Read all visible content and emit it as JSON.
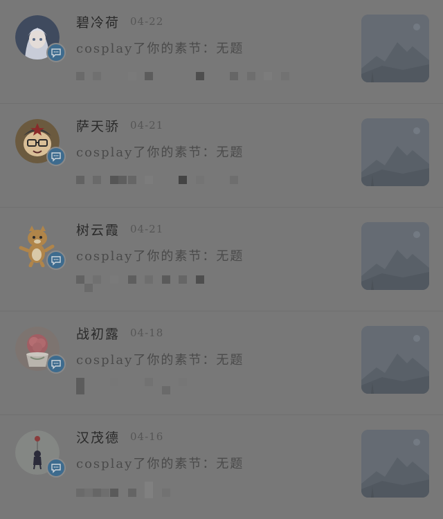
{
  "notifications": [
    {
      "name": "碧冷荷",
      "date": "04-22",
      "message": "cosplay了你的素节：无题",
      "avatar_icon": "anime-girl-avatar-icon",
      "thumbnail_icon": "mountain-placeholder-icon"
    },
    {
      "name": "萨天骄",
      "date": "04-21",
      "message": "cosplay了你的素节：无题",
      "avatar_icon": "cartoon-boy-avatar-icon",
      "thumbnail_icon": "mountain-placeholder-icon"
    },
    {
      "name": "树云霞",
      "date": "04-21",
      "message": "cosplay了你的素节：无题",
      "avatar_icon": "tiger-avatar-icon",
      "thumbnail_icon": "mountain-placeholder-icon"
    },
    {
      "name": "战初露",
      "date": "04-18",
      "message": "cosplay了你的素节：无题",
      "avatar_icon": "flower-cup-avatar-icon",
      "thumbnail_icon": "mountain-placeholder-icon"
    },
    {
      "name": "汉茂德",
      "date": "04-16",
      "message": "cosplay了你的素节：无题",
      "avatar_icon": "balloon-figure-avatar-icon",
      "thumbnail_icon": "mountain-placeholder-icon"
    }
  ],
  "colors": {
    "overlay_background": "#787878",
    "badge_blue": "#3d6b8e",
    "thumbnail_background": "#656b73"
  }
}
